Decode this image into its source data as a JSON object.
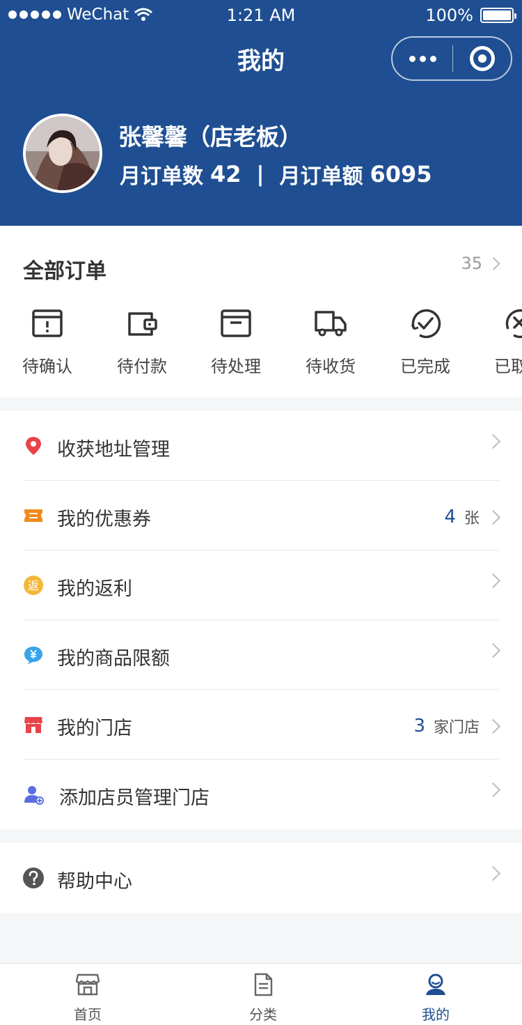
{
  "status_bar": {
    "carrier": "WeChat",
    "time": "1:21 AM",
    "battery": "100%"
  },
  "nav": {
    "title": "我的"
  },
  "user": {
    "name": "张馨馨（店老板）",
    "monthly_orders_label": "月订单数",
    "monthly_orders_value": "42",
    "separator": "|",
    "monthly_amount_label": "月订单额",
    "monthly_amount_value": "6095"
  },
  "orders": {
    "title": "全部订单",
    "count": "35",
    "items": [
      {
        "label": "待确认",
        "icon": "pending-confirm-icon"
      },
      {
        "label": "待付款",
        "icon": "wallet-icon"
      },
      {
        "label": "待处理",
        "icon": "archive-box-icon"
      },
      {
        "label": "待收货",
        "icon": "truck-icon"
      },
      {
        "label": "已完成",
        "icon": "check-circle-icon"
      },
      {
        "label": "已取消",
        "icon": "cancel-circle-icon"
      }
    ]
  },
  "menu": [
    {
      "label": "收获地址管理",
      "icon": "location-pin-icon"
    },
    {
      "label": "我的优惠券",
      "icon": "coupon-icon",
      "value": "4",
      "unit": "张"
    },
    {
      "label": "我的返利",
      "icon": "rebate-icon",
      "icon_text": "返"
    },
    {
      "label": "我的商品限额",
      "icon": "yuan-chat-icon"
    },
    {
      "label": "我的门店",
      "icon": "store-icon",
      "value": "3",
      "unit": "家门店"
    },
    {
      "label": "添加店员管理门店",
      "icon": "add-user-icon"
    }
  ],
  "help": {
    "label": "帮助中心",
    "icon": "question-circle-icon"
  },
  "tabbar": [
    {
      "label": "首页",
      "icon": "shop-icon"
    },
    {
      "label": "分类",
      "icon": "document-icon"
    },
    {
      "label": "我的",
      "icon": "user-icon",
      "active": true
    }
  ],
  "colors": {
    "primary": "#1f4f92",
    "pin": "#e9434a",
    "coupon": "#f08a1c",
    "rebate": "#f5b73b",
    "chat": "#3aa4e8",
    "store": "#e9434a",
    "add_user": "#5b6ee0"
  }
}
